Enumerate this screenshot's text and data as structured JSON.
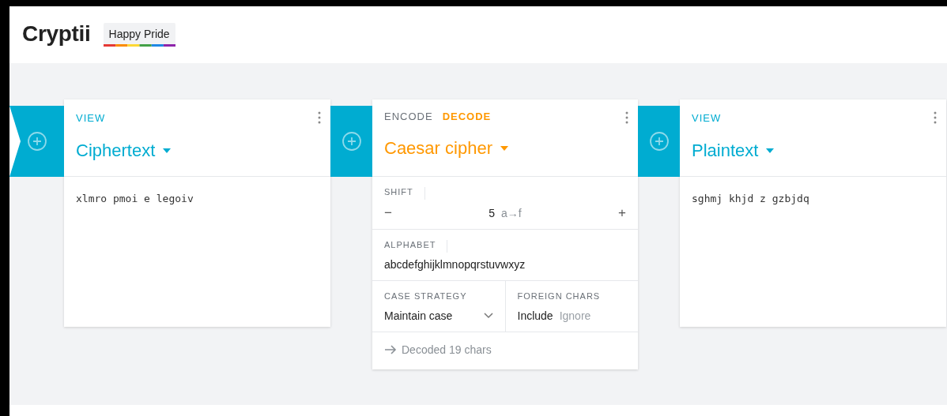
{
  "header": {
    "title": "Cryptii",
    "badge": "Happy Pride"
  },
  "pipeline": [
    {
      "kind": "viewer",
      "type_label": "VIEW",
      "name": "Ciphertext",
      "content": "xlmro pmoi e legoiv"
    },
    {
      "kind": "encoder",
      "modes": [
        {
          "label": "ENCODE",
          "selected": false
        },
        {
          "label": "DECODE",
          "selected": true
        }
      ],
      "name": "Caesar cipher",
      "setting_rows": [
        [
          {
            "kind": "number",
            "label": "SHIFT",
            "minus": "−",
            "value": "5",
            "note": "a→f",
            "plus": "+"
          }
        ],
        [
          {
            "kind": "text",
            "label": "ALPHABET",
            "value": "abcdefghijklmnopqrstuvwxyz"
          }
        ],
        [
          {
            "kind": "select",
            "label": "CASE STRATEGY",
            "value": "Maintain case"
          },
          {
            "kind": "toggle",
            "label": "FOREIGN CHARS",
            "options": [
              {
                "label": "Include",
                "selected": true
              },
              {
                "label": "Ignore",
                "selected": false
              }
            ]
          }
        ]
      ],
      "status": "Decoded 19 chars"
    },
    {
      "kind": "viewer",
      "type_label": "VIEW",
      "name": "Plaintext",
      "content": "sghmj khjd z gzbjdq"
    }
  ]
}
